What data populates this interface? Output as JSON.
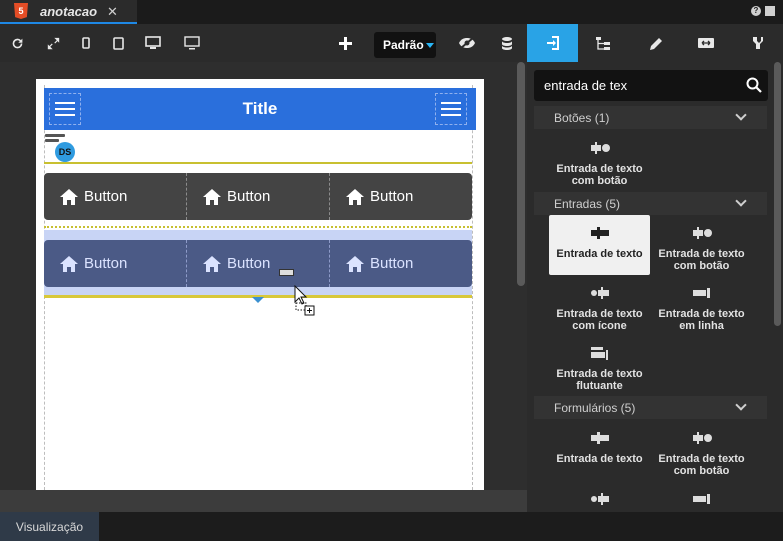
{
  "tab": {
    "title": "anotacao",
    "close": "✕",
    "html5_badge": "5"
  },
  "toolbar": {
    "preset_select": "Padrão",
    "icons": [
      "refresh-icon",
      "fullscreen-icon",
      "phone-icon",
      "tablet-icon",
      "desktop-icon",
      "monitor-icon",
      "add-icon",
      "eye-icon",
      "database-icon",
      "insert-icon",
      "tree-icon",
      "pencil-icon",
      "resize-icon",
      "code-icon"
    ]
  },
  "canvas": {
    "header_title": "Title",
    "avatar_initials": "DS",
    "rows": [
      {
        "buttons": [
          "Button",
          "Button",
          "Button"
        ]
      },
      {
        "buttons": [
          "Button",
          "Button",
          "Button"
        ]
      }
    ]
  },
  "panel": {
    "search_value": "entrada de tex",
    "groups": [
      {
        "label": "Botões (1)",
        "items": [
          "Entrada de texto com botão"
        ]
      },
      {
        "label": "Entradas (5)",
        "items": [
          "Entrada de texto",
          "Entrada de texto com botão",
          "Entrada de texto com ícone",
          "Entrada de texto em linha",
          "Entrada de texto flutuante"
        ]
      },
      {
        "label": "Formulários (5)",
        "items": [
          "Entrada de texto",
          "Entrada de texto com botão"
        ]
      }
    ]
  },
  "bottom": {
    "tab_label": "Visualização"
  },
  "colors": {
    "accent": "#29a3e6",
    "header": "#2a6fdc"
  }
}
